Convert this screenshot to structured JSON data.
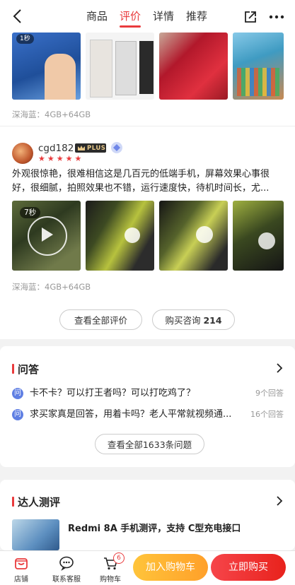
{
  "header": {
    "tabs": [
      {
        "label": "商品",
        "active": false
      },
      {
        "label": "评价",
        "active": true
      },
      {
        "label": "详情",
        "active": false
      },
      {
        "label": "推荐",
        "active": false
      }
    ]
  },
  "review_prev": {
    "video_duration": "1秒",
    "spec": "深海蓝：4GB+64GB"
  },
  "review": {
    "username": "cgd182",
    "badge": "PLUS",
    "stars": 5,
    "text": "外观很惊艳，很难相信这是几百元的低端手机，屏幕效果心事很好，很细腻，拍照效果也不错，运行速度快，待机时间长，尤...",
    "video_duration": "7秒",
    "spec": "深海蓝：4GB+64GB"
  },
  "review_actions": {
    "all_reviews": "查看全部评价",
    "consult_label": "购买咨询",
    "consult_count": "214"
  },
  "qa": {
    "title": "问答",
    "items": [
      {
        "icon": "问",
        "question": "卡不卡？可以打王者吗？可以打吃鸡了？",
        "answers": "9个回答"
      },
      {
        "icon": "问",
        "question": "求买家真是回答，用着卡吗？老人平常就视频通...",
        "answers": "16个回答"
      }
    ],
    "view_all": "查看全部1633条问题"
  },
  "expert": {
    "title": "达人测评",
    "article_title": "Redmi 8A 手机测评，支持 C型充电接口"
  },
  "bottom": {
    "shop": "店铺",
    "service": "联系客服",
    "cart": "购物车",
    "cart_count": "6",
    "add_to_cart": "加入购物车",
    "buy_now": "立即购买"
  },
  "colors": {
    "accent": "#e93b3d",
    "add_cart": "#ffb02e",
    "buy_now": "#ee2f2a",
    "qa_icon": "#5f7fe3"
  }
}
